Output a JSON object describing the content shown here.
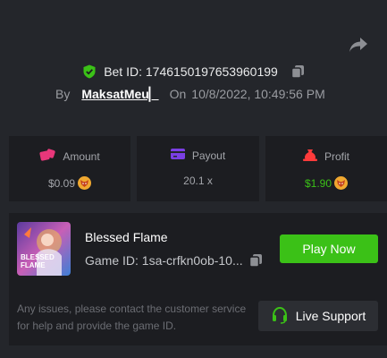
{
  "bet": {
    "id_label": "Bet ID: 1746150197653960199",
    "by_label": "By",
    "username": "MaksatMeu▏",
    "on_label": "On",
    "date": "10/8/2022, 10:49:56 PM"
  },
  "stats": [
    {
      "label": "Amount",
      "value": "$0.09",
      "icon": "dice-icon",
      "color": "#e8377a"
    },
    {
      "label": "Payout",
      "value": "20.1 x",
      "icon": "card-icon",
      "color": "#7b3fe4"
    },
    {
      "label": "Profit",
      "value": "$1.90",
      "icon": "money-bag-icon",
      "color": "#ff3b3b"
    }
  ],
  "game": {
    "title": "Blessed Flame",
    "id_label": "Game ID: 1sa-crfkn0ob-10...",
    "thumb_text": "BLESSED FLAME",
    "play_label": "Play Now"
  },
  "footer": {
    "note": "Any issues, please contact the customer service for help and provide the game ID.",
    "support_label": "Live Support"
  },
  "colors": {
    "background": "#24262b",
    "card": "#1c1d21",
    "accent_green": "#3bc117"
  }
}
